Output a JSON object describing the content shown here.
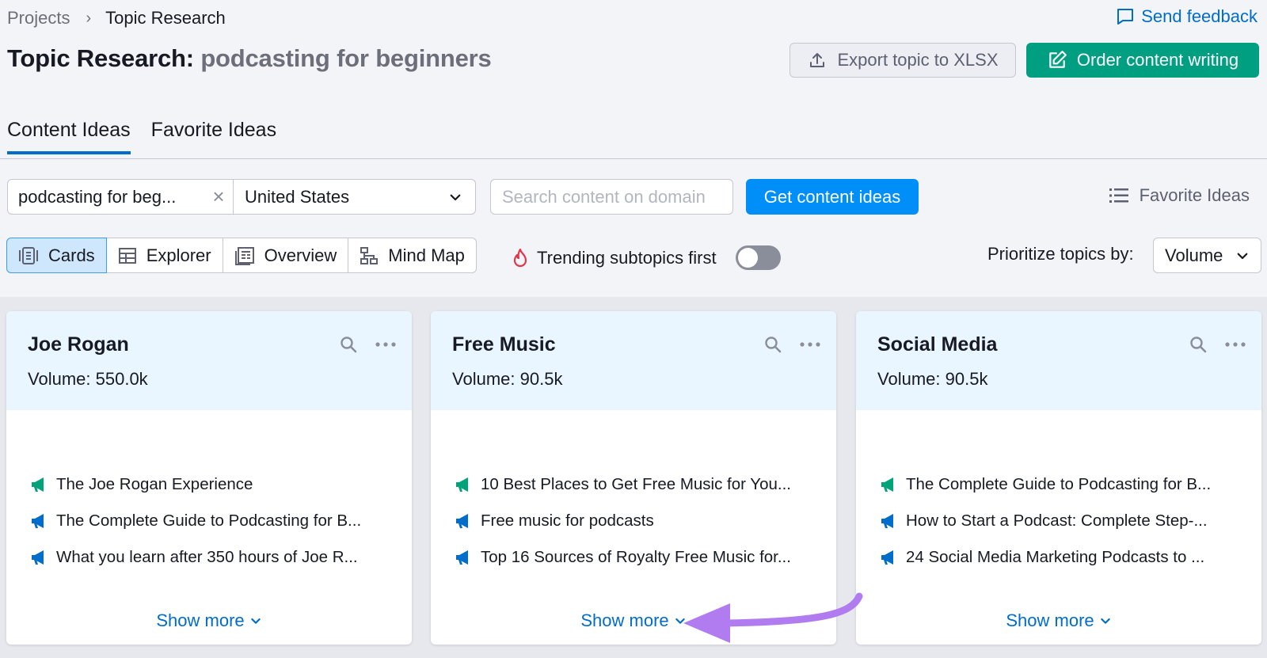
{
  "breadcrumb": {
    "parent": "Projects",
    "current": "Topic Research"
  },
  "header": {
    "feedback": "Send feedback",
    "title_prefix": "Topic Research:",
    "title_topic": "podcasting for beginners",
    "export_label": "Export topic to XLSX",
    "order_label": "Order content writing"
  },
  "tabs": [
    {
      "label": "Content Ideas",
      "active": true
    },
    {
      "label": "Favorite Ideas",
      "active": false
    }
  ],
  "search": {
    "keyword": "podcasting for beg...",
    "country": "United States",
    "domain_placeholder": "Search content on domain",
    "submit_label": "Get content ideas",
    "favorite_link": "Favorite Ideas"
  },
  "views": [
    {
      "label": "Cards",
      "active": true
    },
    {
      "label": "Explorer",
      "active": false
    },
    {
      "label": "Overview",
      "active": false
    },
    {
      "label": "Mind Map",
      "active": false
    }
  ],
  "trending": {
    "label": "Trending subtopics first",
    "enabled": false
  },
  "prioritize": {
    "label": "Prioritize topics by:",
    "value": "Volume"
  },
  "cards": [
    {
      "title": "Joe Rogan",
      "volume_label": "Volume:",
      "volume": "550.0k",
      "items": [
        {
          "text": "The Joe Rogan Experience",
          "icon_color": "#00a37a"
        },
        {
          "text": "The Complete Guide to Podcasting for B...",
          "icon_color": "#006dca"
        },
        {
          "text": "What you learn after 350 hours of Joe R...",
          "icon_color": "#006dca"
        }
      ],
      "show_more": "Show more"
    },
    {
      "title": "Free Music",
      "volume_label": "Volume:",
      "volume": "90.5k",
      "items": [
        {
          "text": "10 Best Places to Get Free Music for You...",
          "icon_color": "#00a37a"
        },
        {
          "text": "Free music for podcasts",
          "icon_color": "#006dca"
        },
        {
          "text": "Top 16 Sources of Royalty Free Music for...",
          "icon_color": "#006dca"
        }
      ],
      "show_more": "Show more"
    },
    {
      "title": "Social Media",
      "volume_label": "Volume:",
      "volume": "90.5k",
      "items": [
        {
          "text": "The Complete Guide to Podcasting for B...",
          "icon_color": "#00a37a"
        },
        {
          "text": "How to Start a Podcast: Complete Step-...",
          "icon_color": "#006dca"
        },
        {
          "text": "24 Social Media Marketing Podcasts to ...",
          "icon_color": "#006dca"
        }
      ],
      "show_more": "Show more"
    }
  ],
  "colors": {
    "accent": "#006dca",
    "primary_button": "#008ff8",
    "order_button": "#009f81",
    "annotation_arrow": "#b07cf0"
  }
}
